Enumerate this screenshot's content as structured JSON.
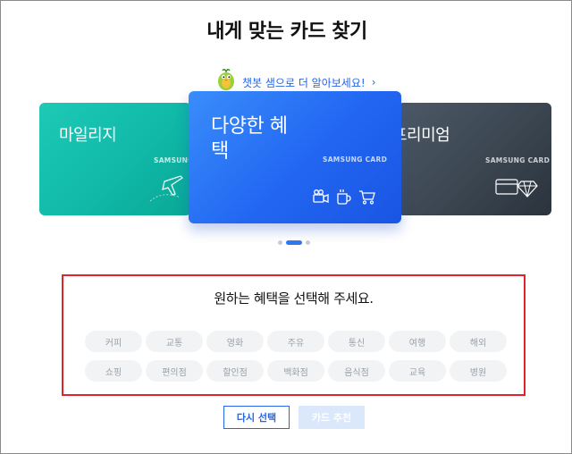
{
  "page": {
    "title": "내게 맞는 카드 찾기"
  },
  "chatbot": {
    "label": "챗봇 샘으로 더 알아보세요!",
    "chevron": "›"
  },
  "cards": {
    "left": {
      "name": "마일리지",
      "brand": "SAMSUNG C"
    },
    "center": {
      "name": "다양한 혜택",
      "brand": "SAMSUNG CARD"
    },
    "right": {
      "name": "프리미엄",
      "brand": "SAMSUNG CARD"
    }
  },
  "carousel": {
    "total": 3,
    "active_index": 1
  },
  "benefit_select": {
    "title": "원하는 혜택을 선택해 주세요.",
    "row1": [
      "커피",
      "교통",
      "영화",
      "주유",
      "통신",
      "여행",
      "해외"
    ],
    "row2": [
      "쇼핑",
      "편의점",
      "할인점",
      "백화점",
      "음식점",
      "교육",
      "병원"
    ]
  },
  "buttons": {
    "reset": "다시 선택",
    "recommend": "카드 추천"
  },
  "colors": {
    "accent": "#2466e8",
    "highlight_border": "#e0222a",
    "chip_bg": "#f2f3f5",
    "chip_text": "#9aa0a8"
  }
}
